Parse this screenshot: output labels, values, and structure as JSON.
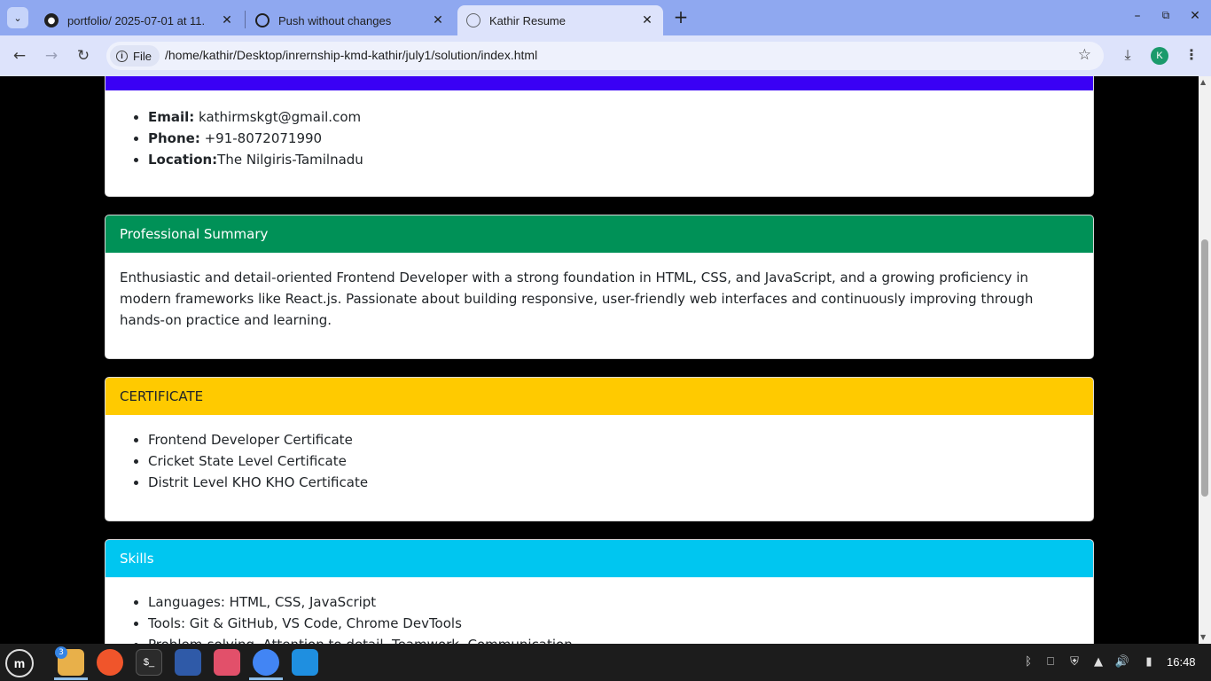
{
  "browser": {
    "tabs": [
      {
        "label": "portfolio/ 2025-07-01 at 11.",
        "icon": "github-icon"
      },
      {
        "label": "Push without changes",
        "icon": "openai-icon"
      },
      {
        "label": "Kathir Resume",
        "icon": "globe-icon"
      }
    ],
    "scheme_chip": "File",
    "url": "/home/kathir/Desktop/inrernship-kmd-kathir/july1/solution/index.html",
    "profile_initial": "K"
  },
  "page": {
    "contact": {
      "items": [
        {
          "label": "Email:",
          "value": " kathirmskgt@gmail.com"
        },
        {
          "label": "Phone:",
          "value": " +91-8072071990"
        },
        {
          "label": "Location:",
          "value": "The Nilgiris-Tamilnadu"
        }
      ],
      "header_color": "#3a00f5"
    },
    "summary": {
      "title": "Professional Summary",
      "text": "Enthusiastic and detail-oriented Frontend Developer with a strong foundation in HTML, CSS, and JavaScript, and a growing proficiency in modern frameworks like React.js. Passionate about building responsive, user-friendly web interfaces and continuously improving through hands-on practice and learning.",
      "header_color": "#009157"
    },
    "certificate": {
      "title": "CERTIFICATE",
      "items": [
        "Frontend Developer Certificate",
        "Cricket State Level Certificate",
        "Distrit Level KHO KHO Certificate"
      ],
      "header_color": "#ffca00"
    },
    "skills": {
      "title": "Skills",
      "items": [
        "Languages: HTML, CSS, JavaScript",
        "Tools: Git & GitHub, VS Code, Chrome DevTools",
        "Problem-solving, Attention to detail, Teamwork, Communication"
      ],
      "header_color": "#00c6f0"
    }
  },
  "taskbar": {
    "files_badge": "3",
    "clock": "16:48"
  }
}
